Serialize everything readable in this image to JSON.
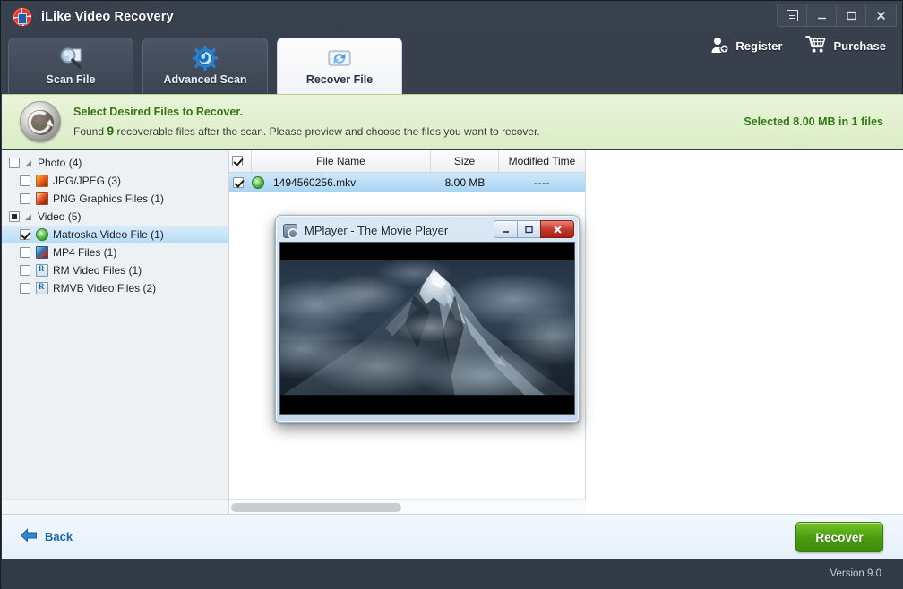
{
  "window": {
    "title": "iLike Video Recovery",
    "logo_icon": "lifebuoy-icon",
    "controls": [
      {
        "name": "menu-button",
        "icon": "list-menu-icon",
        "label": ""
      },
      {
        "name": "minimize-button",
        "icon": "minimize-icon",
        "label": ""
      },
      {
        "name": "maximize-button",
        "icon": "maximize-icon",
        "label": ""
      },
      {
        "name": "close-button",
        "icon": "close-icon",
        "label": ""
      }
    ]
  },
  "tabs": [
    {
      "label": "Scan File",
      "icon": "magnifier-icon",
      "active": false
    },
    {
      "label": "Advanced Scan",
      "icon": "gear-icon",
      "active": false
    },
    {
      "label": "Recover File",
      "icon": "recover-drive-icon",
      "active": true
    }
  ],
  "actions": [
    {
      "label": "Register",
      "icon": "user-add-icon"
    },
    {
      "label": "Purchase",
      "icon": "shopping-cart-icon"
    }
  ],
  "banner": {
    "icon": "recovery-circle-icon",
    "title": "Select Desired Files to Recover.",
    "subtitle_before": "Found ",
    "count": "9",
    "subtitle_after": " recoverable files after the scan. Please preview and choose the files you want to recover.",
    "selection_status": "Selected 8.00 MB in 1 files"
  },
  "sidebar": {
    "items": [
      {
        "label": "Photo (4)",
        "icon": "",
        "checkbox": "unchecked",
        "level": 0,
        "caret": true,
        "selected": false
      },
      {
        "label": "JPG/JPEG (3)",
        "icon": "jpg",
        "checkbox": "unchecked",
        "level": 1,
        "caret": false,
        "selected": false
      },
      {
        "label": "PNG Graphics Files (1)",
        "icon": "png",
        "checkbox": "unchecked",
        "level": 1,
        "caret": false,
        "selected": false
      },
      {
        "label": "Video (5)",
        "icon": "",
        "checkbox": "partial",
        "level": 0,
        "caret": true,
        "selected": false
      },
      {
        "label": "Matroska Video File (1)",
        "icon": "mkv",
        "checkbox": "checked",
        "level": 1,
        "caret": false,
        "selected": true
      },
      {
        "label": "MP4 Files (1)",
        "icon": "mp4",
        "checkbox": "unchecked",
        "level": 1,
        "caret": false,
        "selected": false
      },
      {
        "label": "RM Video Files (1)",
        "icon": "rm",
        "checkbox": "unchecked",
        "level": 1,
        "caret": false,
        "selected": false
      },
      {
        "label": "RMVB Video Files (2)",
        "icon": "rm",
        "checkbox": "unchecked",
        "level": 1,
        "caret": false,
        "selected": false
      }
    ]
  },
  "filelist": {
    "select_all": "checked",
    "columns": [
      "File Name",
      "Size",
      "Modified Time"
    ],
    "rows": [
      {
        "checked": "checked",
        "icon": "mkv",
        "name": "1494560256.mkv",
        "size": "8.00 MB",
        "modified": "----",
        "selected": true
      }
    ]
  },
  "mplayer": {
    "title": "MPlayer - The Movie Player",
    "icon": "mplayer-icon",
    "buttons": [
      {
        "name": "mplayer-minimize-button",
        "glyph": "–"
      },
      {
        "name": "mplayer-restore-button",
        "glyph": "□"
      },
      {
        "name": "mplayer-close-button",
        "glyph": "✕"
      }
    ],
    "video_description": "misty mountain peak"
  },
  "footer": {
    "back_label": "Back",
    "back_icon": "arrow-left-icon",
    "recover_label": "Recover"
  },
  "statusbar": {
    "version": "Version 9.0"
  },
  "colors": {
    "chrome": "#313a47",
    "banner_green": "#3e7016",
    "accent_blue": "#1c66a8",
    "recover_green": "#4a9c10",
    "selection_blue": "#a9d4f3"
  }
}
